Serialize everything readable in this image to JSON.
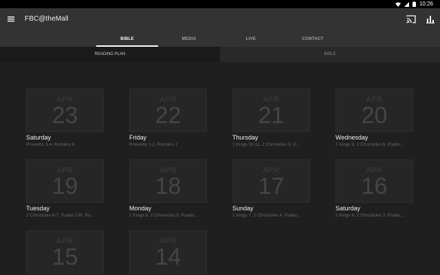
{
  "status_bar": {
    "time": "10:26",
    "icons": [
      "wifi-icon",
      "signal-icon",
      "battery-icon"
    ]
  },
  "app_bar": {
    "title": "FBC@theMall",
    "icons": [
      "menu-icon",
      "cast-icon",
      "bar-chart-icon"
    ]
  },
  "tabs": [
    {
      "label": "BIBLE",
      "active": true
    },
    {
      "label": "MEDIA",
      "active": false
    },
    {
      "label": "LIVE",
      "active": false
    },
    {
      "label": "CONTACT",
      "active": false
    }
  ],
  "subtabs": [
    {
      "label": "READING PLAN",
      "active": true
    },
    {
      "label": "BIBLE",
      "active": false
    }
  ],
  "readings": [
    {
      "month": "APR",
      "day": "23",
      "weekday": "Saturday",
      "passage": "Proverbs 3-4, Romans 8"
    },
    {
      "month": "APR",
      "day": "22",
      "weekday": "Friday",
      "passage": "Proverbs 1-2, Romans 7"
    },
    {
      "month": "APR",
      "day": "21",
      "weekday": "Thursday",
      "passage": "1 Kings 10-11, 2 Chronicles 9, P..."
    },
    {
      "month": "APR",
      "day": "20",
      "weekday": "Wednesday",
      "passage": "1 Kings 9, 2 Chronicles 8, Psalm..."
    },
    {
      "month": "APR",
      "day": "19",
      "weekday": "Tuesday",
      "passage": "2 Chronicles 6-7, Psalm 136, Ro..."
    },
    {
      "month": "APR",
      "day": "18",
      "weekday": "Monday",
      "passage": "1 Kings 8, 2 Chronicles 5, Psalm..."
    },
    {
      "month": "APR",
      "day": "17",
      "weekday": "Sunday",
      "passage": "1 Kings 7, 2 Chronicles 4, Psalm..."
    },
    {
      "month": "APR",
      "day": "16",
      "weekday": "Saturday",
      "passage": "1 Kings 6, 2 Chronicles 3, Psalm..."
    },
    {
      "month": "APR",
      "day": "15",
      "weekday": "",
      "passage": ""
    },
    {
      "month": "APR",
      "day": "14",
      "weekday": "",
      "passage": ""
    }
  ],
  "colors": {
    "app_bar": "#333333",
    "background": "#1f1f1f",
    "tile": "#262626",
    "active_tab_indicator": "#ffffff"
  }
}
